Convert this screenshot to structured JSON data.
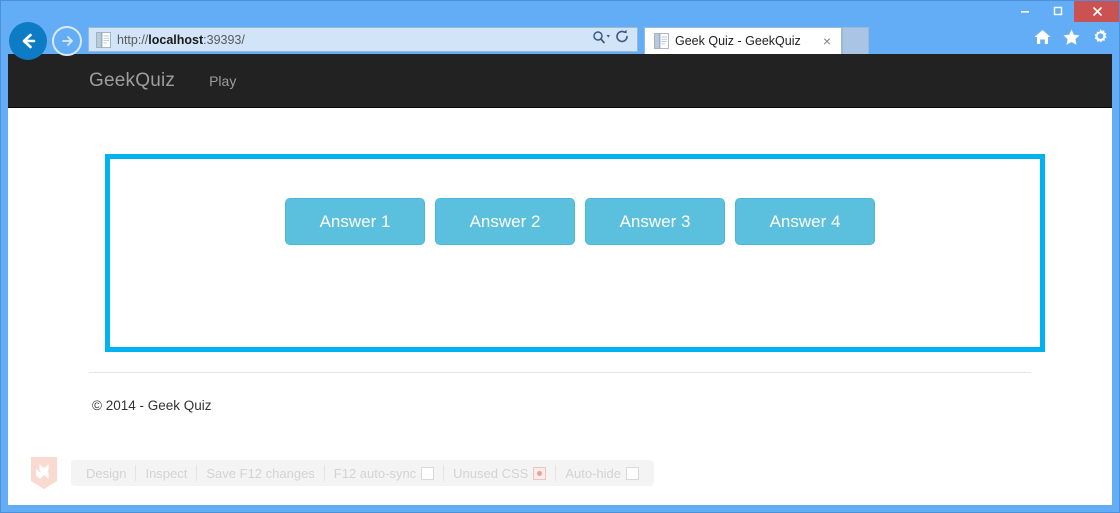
{
  "window": {
    "minimize_label": "Minimize",
    "maximize_label": "Maximize",
    "close_label": "Close"
  },
  "browser": {
    "back_label": "Back",
    "forward_label": "Forward",
    "address": {
      "url_prefix": "http://",
      "url_host": "localhost",
      "url_suffix": ":39393/",
      "full_url": "http://localhost:39393/"
    },
    "search_icon": "search-dropdown-icon",
    "refresh_icon": "refresh-icon",
    "tab": {
      "title": "Geek Quiz - GeekQuiz",
      "close_label": "×",
      "favicon": "page-favicon"
    },
    "newtab_label": "New tab",
    "toolbar_icons": [
      {
        "name": "home-icon",
        "label": "Home"
      },
      {
        "name": "favorites-star-icon",
        "label": "Favorites"
      },
      {
        "name": "settings-gear-icon",
        "label": "Tools"
      }
    ]
  },
  "site": {
    "brand": "GeekQuiz",
    "nav_links": [
      {
        "label": "Play"
      }
    ],
    "answers": [
      {
        "label": "Answer 1"
      },
      {
        "label": "Answer 2"
      },
      {
        "label": "Answer 3"
      },
      {
        "label": "Answer 4"
      }
    ],
    "footer": "© 2014 - Geek Quiz"
  },
  "devbar": {
    "logo": "visual-studio-logo",
    "items": [
      {
        "label": "Design",
        "control": "none"
      },
      {
        "label": "Inspect",
        "control": "none"
      },
      {
        "label": "Save F12 changes",
        "control": "none"
      },
      {
        "label": "F12 auto-sync",
        "control": "checkbox"
      },
      {
        "label": "Unused CSS",
        "control": "record"
      },
      {
        "label": "Auto-hide",
        "control": "checkbox"
      }
    ]
  },
  "colors": {
    "chrome_blue": "#62adf5",
    "navbar_dark": "#222222",
    "answer_button": "#5bc0de",
    "highlight_border": "#00b2f0",
    "close_button": "#cb5252"
  }
}
